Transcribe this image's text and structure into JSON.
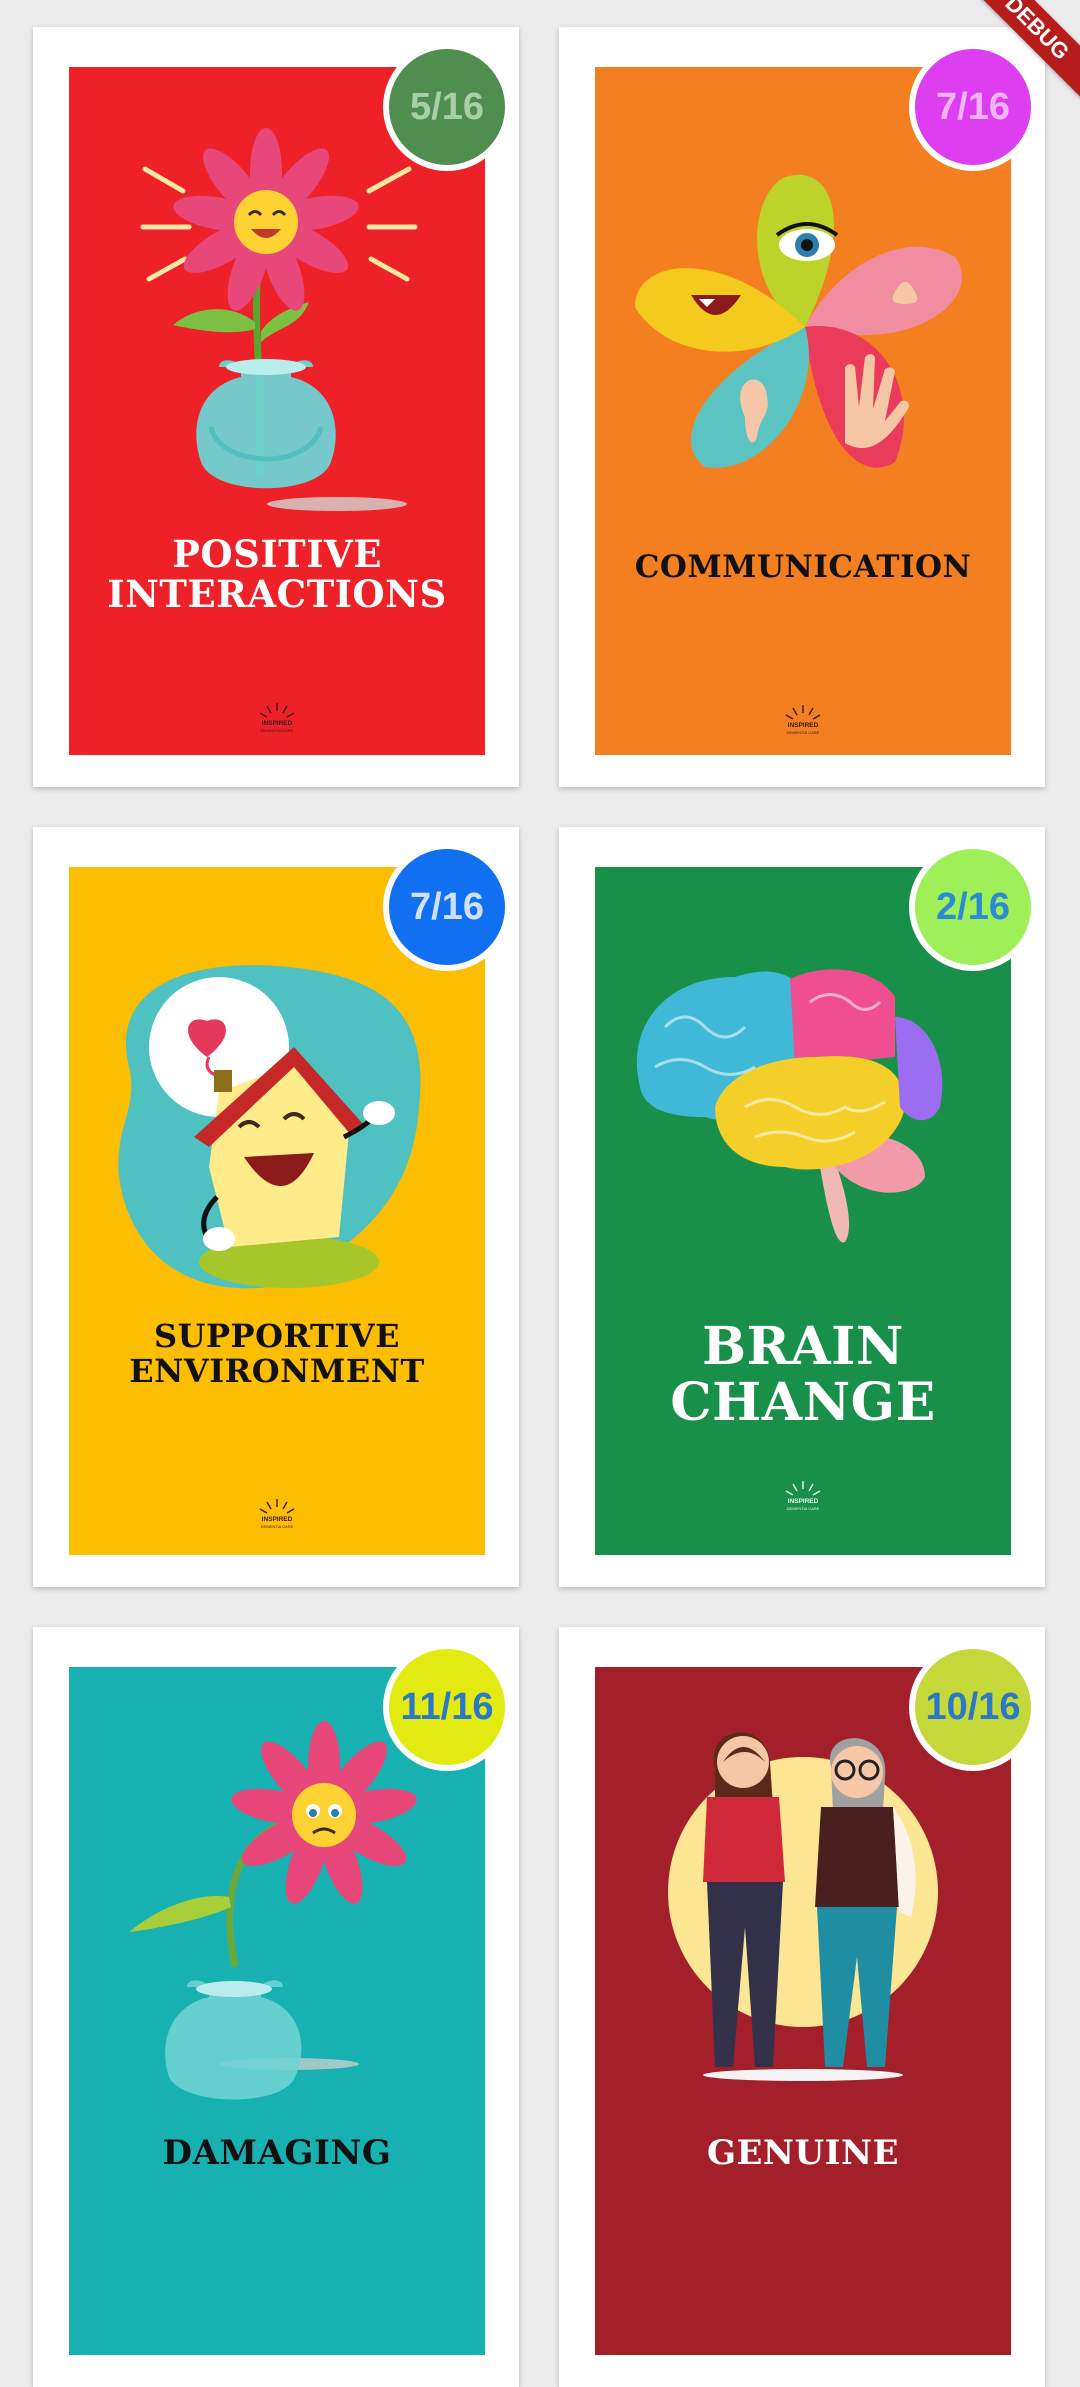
{
  "debug_ribbon": "DEBUG",
  "logo_text": "INSPIRED",
  "logo_subtext": "DEMENTIA CARE",
  "cards": [
    {
      "badge": "5/16",
      "title_line1": "POSITIVE",
      "title_line2": "INTERACTIONS",
      "bg_color": "#ee2028",
      "badge_color": "#4f8e4f",
      "badge_text_color": "#a9cfa9",
      "illustration": "happy-flower-in-vase"
    },
    {
      "badge": "7/16",
      "title_line1": "COMMUNICATION",
      "title_line2": "",
      "bg_color": "#f47f20",
      "badge_color": "#dd3ff0",
      "badge_text_color": "#f2b4f8",
      "illustration": "five-senses-petals"
    },
    {
      "badge": "7/16",
      "title_line1": "SUPPORTIVE",
      "title_line2": "ENVIRONMENT",
      "bg_color": "#fdbd00",
      "badge_color": "#1170f2",
      "badge_text_color": "#cfe0fc",
      "illustration": "happy-house-with-heart"
    },
    {
      "badge": "2/16",
      "title_line1": "BRAIN",
      "title_line2": "CHANGE",
      "bg_color": "#19904a",
      "badge_color": "#9fef59",
      "badge_text_color": "#2b8bd6",
      "illustration": "colorful-brain"
    },
    {
      "badge": "11/16",
      "title_line1": "DAMAGING",
      "title_line2": "",
      "bg_color": "#17b1b2",
      "badge_color": "#e3ea12",
      "badge_text_color": "#2a78c6",
      "illustration": "sad-wilting-flower"
    },
    {
      "badge": "10/16",
      "title_line1": "GENUINE",
      "title_line2": "",
      "bg_color": "#a3202a",
      "badge_color": "#c4d83a",
      "badge_text_color": "#2a78c6",
      "illustration": "two-women-smiling"
    }
  ]
}
